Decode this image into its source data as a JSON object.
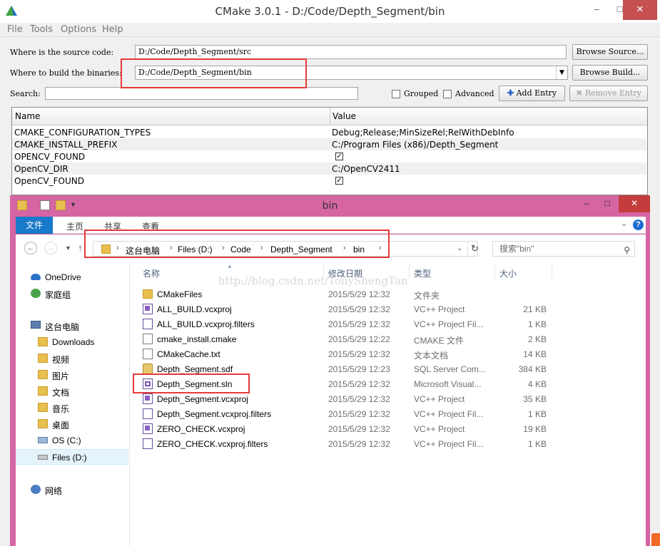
{
  "cmake": {
    "title": "CMake 3.0.1 - D:/Code/Depth_Segment/bin",
    "menu": [
      "File",
      "Tools",
      "Options",
      "Help"
    ],
    "source_label": "Where is the source code:",
    "source_value": "D:/Code/Depth_Segment/src",
    "browse_source": "Browse Source...",
    "build_label": "Where to build the binaries:",
    "build_value": "D:/Code/Depth_Segment/bin",
    "browse_build": "Browse Build...",
    "search_label": "Search:",
    "search_value": "",
    "grouped_label": "Grouped",
    "advanced_label": "Advanced",
    "add_entry": "Add Entry",
    "remove_entry": "Remove Entry",
    "table": {
      "col_name": "Name",
      "col_value": "Value",
      "rows": [
        {
          "name": "CMAKE_CONFIGURATION_TYPES",
          "value": "Debug;Release;MinSizeRel;RelWithDebInfo"
        },
        {
          "name": "CMAKE_INSTALL_PREFIX",
          "value": "C:/Program Files (x86)/Depth_Segment"
        },
        {
          "name": "OPENCV_FOUND",
          "value": "",
          "checked": true
        },
        {
          "name": "OpenCV_DIR",
          "value": "C:/OpenCV2411"
        },
        {
          "name": "OpenCV_FOUND",
          "value": "",
          "checked": true
        }
      ]
    }
  },
  "explorer": {
    "title": "bin",
    "ribbon_tabs": {
      "file": "文件",
      "home": "主页",
      "share": "共享",
      "view": "查看"
    },
    "help": "?",
    "breadcrumb": [
      "这台电脑",
      "Files (D:)",
      "Code",
      "Depth_Segment",
      "bin"
    ],
    "search_placeholder": "搜索\"bin\"",
    "nav": {
      "onedrive": "OneDrive",
      "homegroup": "家庭组",
      "this_pc": "这台电脑",
      "downloads": "Downloads",
      "videos": "视频",
      "pictures": "图片",
      "documents": "文档",
      "music": "音乐",
      "desktop": "桌面",
      "os_c": "OS (C:)",
      "files_d": "Files (D:)",
      "network": "网络"
    },
    "columns": {
      "name": "名称",
      "date": "修改日期",
      "type": "类型",
      "size": "大小"
    },
    "watermark": "http://blog.csdn.net/TonyShengTan",
    "files": [
      {
        "name": "CMakeFiles",
        "date": "2015/5/29 12:32",
        "type": "文件夹",
        "size": "",
        "icon": "folder-icon"
      },
      {
        "name": "ALL_BUILD.vcxproj",
        "date": "2015/5/29 12:32",
        "type": "VC++ Project",
        "size": "21 KB",
        "icon": "vcxproj-icon"
      },
      {
        "name": "ALL_BUILD.vcxproj.filters",
        "date": "2015/5/29 12:32",
        "type": "VC++ Project Fil...",
        "size": "1 KB",
        "icon": "filters-icon"
      },
      {
        "name": "cmake_install.cmake",
        "date": "2015/5/29 12:22",
        "type": "CMAKE 文件",
        "size": "2 KB",
        "icon": "file-icon"
      },
      {
        "name": "CMakeCache.txt",
        "date": "2015/5/29 12:32",
        "type": "文本文档",
        "size": "14 KB",
        "icon": "text-file-icon"
      },
      {
        "name": "Depth_Segment.sdf",
        "date": "2015/5/29 12:23",
        "type": "SQL Server Com...",
        "size": "384 KB",
        "icon": "database-icon"
      },
      {
        "name": "Depth_Segment.sln",
        "date": "2015/5/29 12:32",
        "type": "Microsoft Visual...",
        "size": "4 KB",
        "icon": "solution-icon"
      },
      {
        "name": "Depth_Segment.vcxproj",
        "date": "2015/5/29 12:32",
        "type": "VC++ Project",
        "size": "35 KB",
        "icon": "vcxproj-icon"
      },
      {
        "name": "Depth_Segment.vcxproj.filters",
        "date": "2015/5/29 12:32",
        "type": "VC++ Project Fil...",
        "size": "1 KB",
        "icon": "filters-icon"
      },
      {
        "name": "ZERO_CHECK.vcxproj",
        "date": "2015/5/29 12:32",
        "type": "VC++ Project",
        "size": "19 KB",
        "icon": "vcxproj-icon"
      },
      {
        "name": "ZERO_CHECK.vcxproj.filters",
        "date": "2015/5/29 12:32",
        "type": "VC++ Project Fil...",
        "size": "1 KB",
        "icon": "filters-icon"
      }
    ]
  },
  "colors": {
    "explorer_frame": "#d665a3",
    "ribbon_file_tab": "#1979ca",
    "highlight_box": "#e53a3a",
    "close_button": "#c75050"
  }
}
